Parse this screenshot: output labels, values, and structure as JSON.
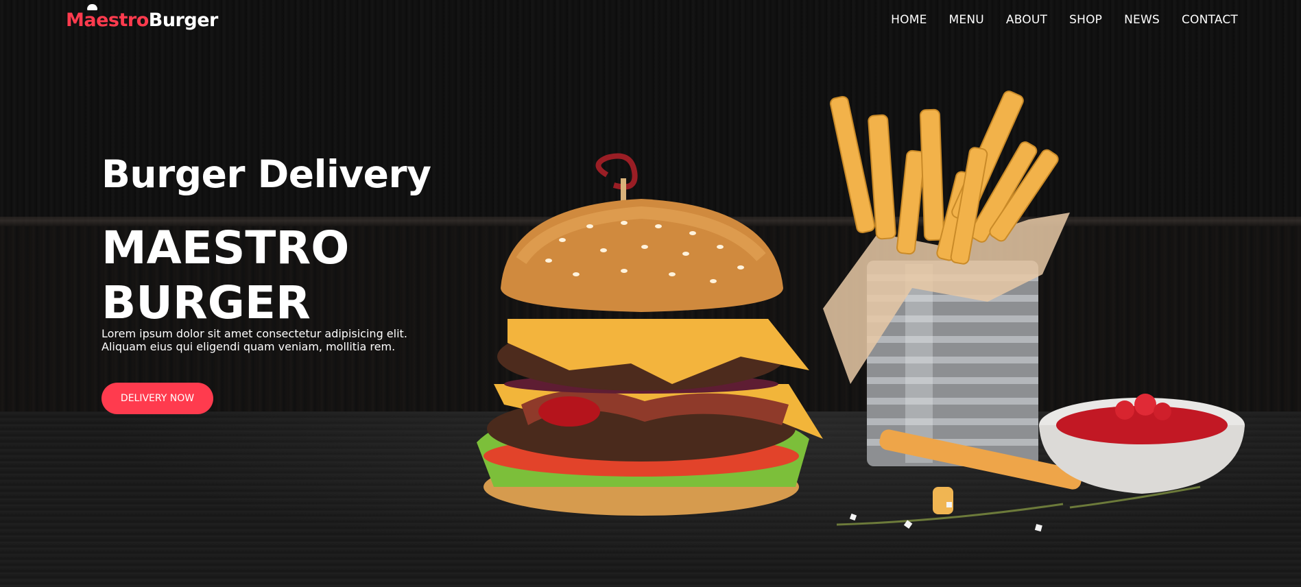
{
  "brand": {
    "name_part1": "Maestro",
    "name_part2": "Burger"
  },
  "nav": {
    "items": [
      "HOME",
      "MENU",
      "ABOUT",
      "SHOP",
      "NEWS",
      "CONTACT"
    ]
  },
  "hero": {
    "subtitle": "Burger Delivery",
    "headline_line1": "MAESTRO",
    "headline_line2": "BURGER",
    "description_line1": "Lorem ipsum dolor sit amet consectetur adipisicing elit.",
    "description_line2": "Aliquam eius qui eligendi quam veniam, mollitia rem.",
    "cta_label": "DELIVERY NOW"
  },
  "colors": {
    "accent": "#ff3b4e",
    "text": "#ffffff",
    "background": "#111111"
  }
}
